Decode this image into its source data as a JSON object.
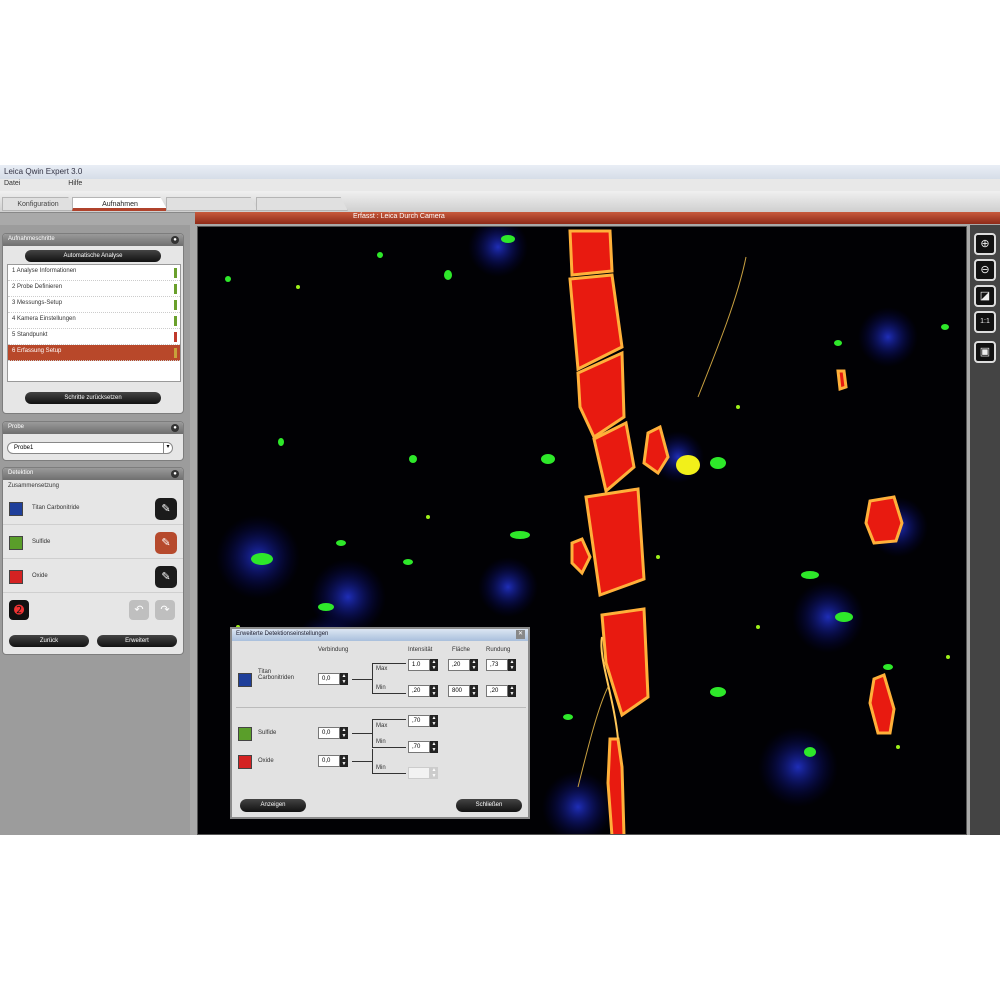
{
  "window": {
    "title": "Leica Qwin Expert 3.0"
  },
  "menu": {
    "items": [
      "Datei",
      "Hilfe"
    ]
  },
  "tabs": [
    {
      "label": "Konfiguration",
      "active": false
    },
    {
      "label": "Aufnahmen",
      "active": true
    },
    {
      "label": "",
      "active": false
    },
    {
      "label": "",
      "active": false
    }
  ],
  "image_view": {
    "title": "Erfasst : Leica Durch Camera"
  },
  "analysis_panel": {
    "title": "Aufnahmeschritte",
    "mode_button": "Automatische Analyse",
    "steps": [
      "1 Analyse Informationen",
      "2 Probe Definieren",
      "3 Messungs-Setup",
      "4 Kamera Einstellungen",
      "5 Standpunkt",
      "6 Erfassung Setup"
    ],
    "active_step": 5,
    "step_marks": [
      "#6aa02c",
      "#6aa02c",
      "#6aa02c",
      "#6aa02c",
      "#c0392b",
      "#c8a23a"
    ],
    "reset_button": "Schritte zurücksetzen"
  },
  "probe_panel": {
    "title": "Probe",
    "value": "Probe1",
    "dropdown_icon": "dropdown-icon"
  },
  "detection_panel": {
    "title": "Detektion",
    "subtitle": "Zusammensetzung",
    "phases": [
      {
        "name": "Titan Carbonitride",
        "color": "#1f3f9a",
        "edit_active": false
      },
      {
        "name": "Sulfide",
        "color": "#5a9e2a",
        "edit_active": true
      },
      {
        "name": "Oxide",
        "color": "#d42222",
        "edit_active": false
      }
    ],
    "back_button": "Zurück",
    "next_button": "Erweitert"
  },
  "dialog": {
    "title": "Erweiterte Detektionseinstellungen",
    "col_min": "Verbindung",
    "col_intensity": "Intensität",
    "col_size": "Fläche",
    "col_shape": "Rundung",
    "rows": [
      {
        "name": "Titan Carbonitriden",
        "color": "#1f3f9a",
        "value": "0,0",
        "max_label": "Max",
        "min_label": "Min",
        "intensity_max": "1.0",
        "intensity_min": ",20",
        "size_max": ",20",
        "size_min": "800",
        "shape_max": ",73",
        "shape_min": ",20"
      },
      {
        "name": "Sulfide",
        "color": "#5a9e2a",
        "value": "0,0",
        "max_label": "Max",
        "min_label": "Min",
        "intensity_max": ",70",
        "intensity_min": ",70"
      },
      {
        "name": "Oxide",
        "color": "#d42222",
        "value": "0,0",
        "max_label": "Max",
        "min_label": "Min",
        "intensity_min": ""
      }
    ],
    "apply_button": "Anzeigen",
    "close_button": "Schließen"
  },
  "toolbar": {
    "icons": [
      "zoom-in-icon",
      "zoom-out-icon",
      "fit-icon",
      "actual-size-icon",
      "overlay-icon"
    ],
    "glyphs": [
      "⊕",
      "⊖",
      "◪",
      "1:1",
      "▣"
    ]
  }
}
